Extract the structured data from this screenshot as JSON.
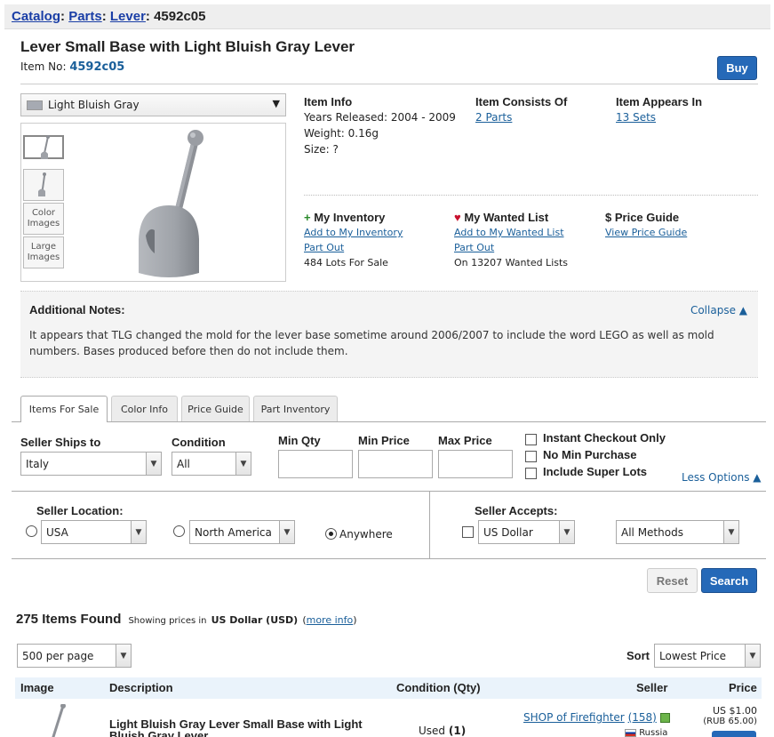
{
  "breadcrumb": {
    "catalog": "Catalog",
    "parts": "Parts",
    "lever": "Lever",
    "sep": ":",
    "current": "4592c05"
  },
  "item": {
    "title": "Lever Small Base with Light Bluish Gray Lever",
    "item_no_label": "Item No:",
    "item_no": "4592c05"
  },
  "buy_label": "Buy",
  "color_select": {
    "value": "Light Bluish Gray",
    "swatch": "#a6aab2"
  },
  "thumbs": {
    "color_images": "Color Images",
    "large_images": "Large Images"
  },
  "info": {
    "header": "Item Info",
    "years": "Years Released: 2004 - 2009",
    "weight": "Weight: 0.16g",
    "size": "Size: ?"
  },
  "consists": {
    "header": "Item Consists Of",
    "link": "2 Parts"
  },
  "appears": {
    "header": "Item Appears In",
    "link": "13 Sets"
  },
  "inventory": {
    "icon": "+",
    "header": "My Inventory",
    "add": "Add to My Inventory",
    "part_out": "Part Out",
    "lots": "484 Lots For Sale"
  },
  "wanted": {
    "icon": "♥",
    "header": "My Wanted List",
    "add": "Add to My Wanted List",
    "part_out": "Part Out",
    "count": "On 13207 Wanted Lists"
  },
  "price_guide": {
    "icon": "$",
    "header": "Price Guide",
    "link": "View Price Guide"
  },
  "notes": {
    "title": "Additional Notes:",
    "collapse": "Collapse ▲",
    "body": "It appears that TLG changed the mold for the lever base sometime around 2006/2007 to include the word LEGO as well as mold numbers. Bases produced before then do not include them."
  },
  "tabs": [
    "Items For Sale",
    "Color Info",
    "Price Guide",
    "Part Inventory"
  ],
  "filters": {
    "ships_to_label": "Seller Ships to",
    "ships_to_value": "Italy",
    "condition_label": "Condition",
    "condition_value": "All",
    "min_qty_label": "Min Qty",
    "min_price_label": "Min Price",
    "max_price_label": "Max Price",
    "instant_checkout": "Instant Checkout Only",
    "no_min_purchase": "No Min Purchase",
    "super_lots": "Include Super Lots",
    "less_options": "Less Options ▲"
  },
  "location": {
    "label": "Seller Location:",
    "usa": "USA",
    "north_america": "North America",
    "anywhere": "Anywhere"
  },
  "accepts": {
    "label": "Seller Accepts:",
    "currency": "US Dollar",
    "methods": "All Methods"
  },
  "buttons": {
    "reset": "Reset",
    "search": "Search"
  },
  "results": {
    "count": "275 Items Found",
    "showing": "Showing prices in",
    "currency": "US Dollar (USD)",
    "more_info": "more info",
    "per_page": "500 per page",
    "sort_label": "Sort",
    "sort_value": "Lowest Price"
  },
  "table": {
    "headers": [
      "Image",
      "Description",
      "Condition (Qty)",
      "Seller",
      "Price"
    ],
    "row": {
      "description": "Light Bluish Gray Lever Small Base with Light Bluish Gray Lever",
      "condition": "Used",
      "qty": "(1)",
      "seller": "SHOP of Firefighter",
      "feedback": "(158)",
      "country": "Russia",
      "price": "US $1.00",
      "price_local": "(RUB 65.00)"
    }
  }
}
